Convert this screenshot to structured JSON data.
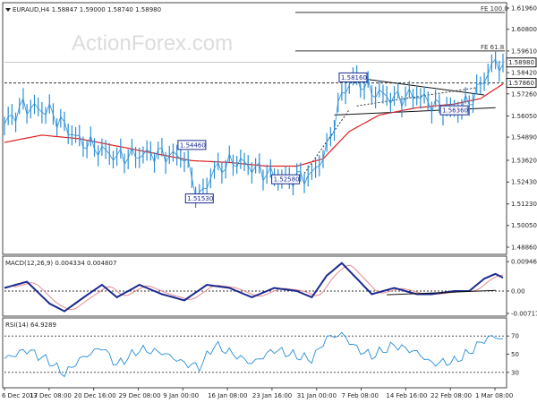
{
  "watermark": "ActionForex.com",
  "colors": {
    "price": "#2a8fd6",
    "ma": "#e02020",
    "macd": "#1b2a8f",
    "signal": "#e58a8a",
    "rsi": "#2a8fd6",
    "trend": "#111111"
  },
  "price_panel": {
    "header": "EURAUD,H4  1.58847 1.59000 1.58740 1.58980",
    "y_ticks": [
      "1.61960",
      "1.60800",
      "1.59610",
      "1.58420",
      "1.57260",
      "1.56050",
      "1.54890",
      "1.53620",
      "1.52430",
      "1.51230",
      "1.50050",
      "1.48860"
    ],
    "y_range": [
      1.4886,
      1.6196
    ],
    "current_price": "1.58980",
    "marked_level": "1.57860",
    "fib_labels": [
      {
        "text": "FE 100.0",
        "price": 1.6172
      },
      {
        "text": "FE 61.8",
        "price": 1.5961
      }
    ],
    "callouts": [
      {
        "text": "1.58160",
        "price": 1.5816,
        "index": 93
      },
      {
        "text": "1.56360",
        "price": 1.5636,
        "index": 120
      },
      {
        "text": "1.54460",
        "price": 1.5446,
        "index": 50
      },
      {
        "text": "1.52580",
        "price": 1.5258,
        "index": 75
      },
      {
        "text": "1.51530",
        "price": 1.5153,
        "index": 52
      }
    ]
  },
  "macd_panel": {
    "header": "MACD(12,26,9) 0.004334 0.004807",
    "y_ticks": [
      "0.009466",
      "0.00",
      "-0.007178"
    ],
    "y_range": [
      -0.0072,
      0.0095
    ]
  },
  "rsi_panel": {
    "header": "RSI(14) 64.9289",
    "y_ticks": [
      "70",
      "50",
      "30"
    ],
    "y_range": [
      15,
      85
    ]
  },
  "x_labels": [
    "6 Dec 2017",
    "13 Dec 08:00",
    "20 Dec 16:00",
    "29 Dec 08:00",
    "9 Jan 00:00",
    "16 Jan 08:00",
    "23 Jan 16:00",
    "31 Jan 00:00",
    "7 Feb 08:00",
    "14 Feb 16:00",
    "22 Feb 08:00",
    "1 Mar 08:00"
  ],
  "chart_data": {
    "type": "line",
    "title": "EURAUD,H4",
    "x": [
      "6 Dec 2017",
      "13 Dec 08:00",
      "20 Dec 16:00",
      "29 Dec 08:00",
      "9 Jan 00:00",
      "16 Jan 08:00",
      "23 Jan 16:00",
      "31 Jan 00:00",
      "7 Feb 08:00",
      "14 Feb 16:00",
      "22 Feb 08:00",
      "1 Mar 08:00"
    ],
    "price_keypoints": [
      [
        0,
        1.556
      ],
      [
        5,
        1.566
      ],
      [
        12,
        1.563
      ],
      [
        20,
        1.547
      ],
      [
        30,
        1.538
      ],
      [
        40,
        1.54
      ],
      [
        48,
        1.538
      ],
      [
        52,
        1.5153
      ],
      [
        56,
        1.531
      ],
      [
        62,
        1.536
      ],
      [
        70,
        1.529
      ],
      [
        75,
        1.5258
      ],
      [
        82,
        1.528
      ],
      [
        86,
        1.542
      ],
      [
        90,
        1.572
      ],
      [
        93,
        1.5816
      ],
      [
        98,
        1.574
      ],
      [
        104,
        1.57
      ],
      [
        110,
        1.572
      ],
      [
        115,
        1.566
      ],
      [
        120,
        1.5636
      ],
      [
        124,
        1.568
      ],
      [
        127,
        1.577
      ],
      [
        130,
        1.588
      ],
      [
        133,
        1.5898
      ]
    ],
    "ma_keypoints": [
      [
        0,
        1.546
      ],
      [
        10,
        1.55
      ],
      [
        20,
        1.548
      ],
      [
        30,
        1.544
      ],
      [
        40,
        1.54
      ],
      [
        50,
        1.536
      ],
      [
        60,
        1.535
      ],
      [
        70,
        1.533
      ],
      [
        78,
        1.533
      ],
      [
        85,
        1.537
      ],
      [
        92,
        1.552
      ],
      [
        100,
        1.561
      ],
      [
        110,
        1.565
      ],
      [
        120,
        1.567
      ],
      [
        127,
        1.57
      ],
      [
        133,
        1.578
      ]
    ],
    "macd_keypoints": [
      [
        0,
        0.001
      ],
      [
        6,
        0.003
      ],
      [
        12,
        -0.004
      ],
      [
        16,
        -0.0065
      ],
      [
        20,
        -0.003
      ],
      [
        26,
        0.002
      ],
      [
        30,
        -0.002
      ],
      [
        36,
        0.002
      ],
      [
        42,
        -0.001
      ],
      [
        48,
        -0.003
      ],
      [
        54,
        0.002
      ],
      [
        60,
        0.001
      ],
      [
        66,
        -0.002
      ],
      [
        72,
        0.001
      ],
      [
        78,
        0.0
      ],
      [
        82,
        -0.002
      ],
      [
        86,
        0.005
      ],
      [
        90,
        0.009
      ],
      [
        94,
        0.004
      ],
      [
        98,
        -0.001
      ],
      [
        104,
        0.001
      ],
      [
        110,
        -0.001
      ],
      [
        114,
        -0.001
      ],
      [
        120,
        0.0
      ],
      [
        124,
        0.0
      ],
      [
        128,
        0.004
      ],
      [
        131,
        0.0055
      ],
      [
        133,
        0.0043
      ]
    ],
    "rsi_keypoints": [
      [
        0,
        45
      ],
      [
        6,
        55
      ],
      [
        12,
        42
      ],
      [
        16,
        28
      ],
      [
        20,
        44
      ],
      [
        26,
        58
      ],
      [
        30,
        38
      ],
      [
        36,
        55
      ],
      [
        42,
        52
      ],
      [
        48,
        40
      ],
      [
        52,
        36
      ],
      [
        56,
        60
      ],
      [
        60,
        52
      ],
      [
        66,
        40
      ],
      [
        72,
        55
      ],
      [
        78,
        48
      ],
      [
        82,
        44
      ],
      [
        86,
        68
      ],
      [
        90,
        72
      ],
      [
        94,
        56
      ],
      [
        98,
        48
      ],
      [
        104,
        60
      ],
      [
        110,
        52
      ],
      [
        114,
        40
      ],
      [
        120,
        42
      ],
      [
        124,
        52
      ],
      [
        128,
        66
      ],
      [
        131,
        70
      ],
      [
        133,
        65
      ]
    ],
    "levels": {
      "dashed_support": 1.5786,
      "fe_100": 1.6172,
      "fe_61_8": 1.5961,
      "rsi_upper": 70,
      "rsi_lower": 30,
      "macd_zero": 0
    }
  }
}
